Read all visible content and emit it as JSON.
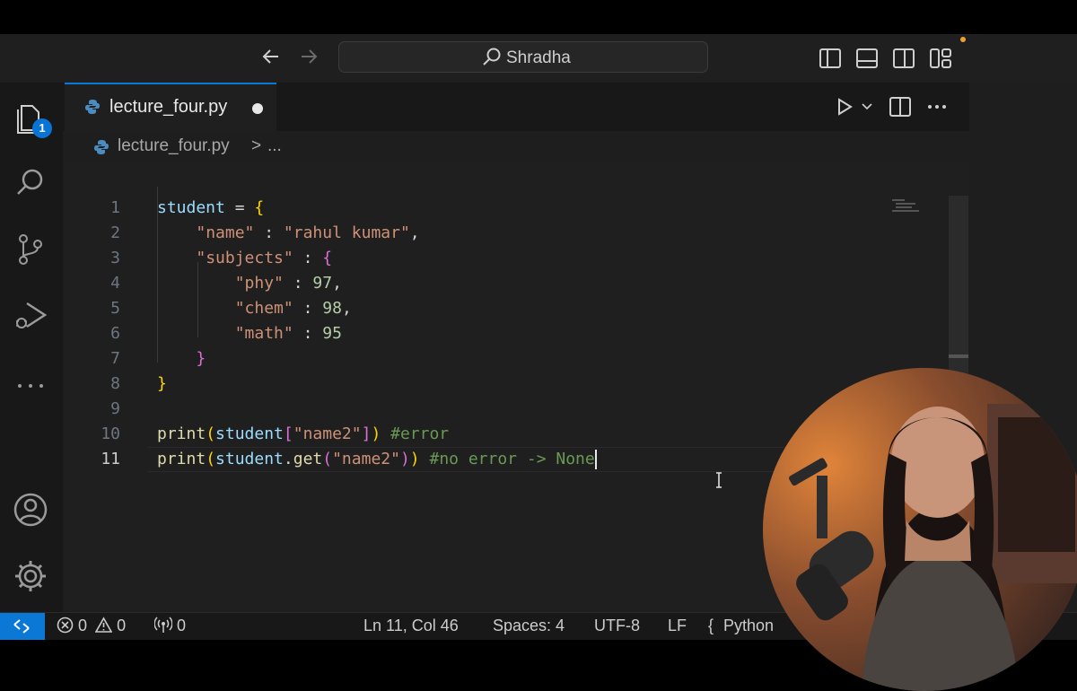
{
  "titlebar": {
    "back_icon": "arrow-left-icon",
    "forward_icon": "arrow-right-icon",
    "search_text": "Shradha",
    "layout_icons": [
      "toggle-primary-sidebar-icon",
      "toggle-panel-icon",
      "toggle-secondary-sidebar-icon",
      "customize-layout-icon"
    ]
  },
  "activity_bar": {
    "items": [
      "explorer-icon",
      "search-icon",
      "source-control-icon",
      "run-and-debug-icon",
      "more-icon"
    ],
    "explorer_badge": "1",
    "bottom_items": [
      "account-icon",
      "settings-icon"
    ]
  },
  "tab": {
    "label": "lecture_four.py",
    "modified": true
  },
  "editor_actions": [
    "run-python-file-icon",
    "run-dropdown-icon",
    "split-editor-icon",
    "more-actions-icon"
  ],
  "breadcrumb": {
    "file": "lecture_four.py",
    "separator": ">",
    "rest": "..."
  },
  "code": {
    "line_numbers": [
      "1",
      "2",
      "3",
      "4",
      "5",
      "6",
      "7",
      "8",
      "9",
      "10",
      "11"
    ],
    "active_line": 11,
    "lines": [
      [
        {
          "t": "student",
          "c": "var"
        },
        {
          "t": " = ",
          "c": "plain"
        },
        {
          "t": "{",
          "c": "b1"
        }
      ],
      [
        {
          "t": "    ",
          "c": "plain"
        },
        {
          "t": "\"name\"",
          "c": "str"
        },
        {
          "t": " : ",
          "c": "plain"
        },
        {
          "t": "\"rahul kumar\"",
          "c": "str"
        },
        {
          "t": ",",
          "c": "plain"
        }
      ],
      [
        {
          "t": "    ",
          "c": "plain"
        },
        {
          "t": "\"subjects\"",
          "c": "str"
        },
        {
          "t": " : ",
          "c": "plain"
        },
        {
          "t": "{",
          "c": "b2"
        }
      ],
      [
        {
          "t": "        ",
          "c": "plain"
        },
        {
          "t": "\"phy\"",
          "c": "str"
        },
        {
          "t": " : ",
          "c": "plain"
        },
        {
          "t": "97",
          "c": "num"
        },
        {
          "t": ",",
          "c": "plain"
        }
      ],
      [
        {
          "t": "        ",
          "c": "plain"
        },
        {
          "t": "\"chem\"",
          "c": "str"
        },
        {
          "t": " : ",
          "c": "plain"
        },
        {
          "t": "98",
          "c": "num"
        },
        {
          "t": ",",
          "c": "plain"
        }
      ],
      [
        {
          "t": "        ",
          "c": "plain"
        },
        {
          "t": "\"math\"",
          "c": "str"
        },
        {
          "t": " : ",
          "c": "plain"
        },
        {
          "t": "95",
          "c": "num"
        }
      ],
      [
        {
          "t": "    ",
          "c": "plain"
        },
        {
          "t": "}",
          "c": "b2"
        }
      ],
      [
        {
          "t": "}",
          "c": "b1"
        }
      ],
      [],
      [
        {
          "t": "print",
          "c": "fn"
        },
        {
          "t": "(",
          "c": "b1"
        },
        {
          "t": "student",
          "c": "var"
        },
        {
          "t": "[",
          "c": "b2"
        },
        {
          "t": "\"name2\"",
          "c": "str"
        },
        {
          "t": "]",
          "c": "b2"
        },
        {
          "t": ")",
          "c": "b1"
        },
        {
          "t": " ",
          "c": "plain"
        },
        {
          "t": "#error",
          "c": "cmt"
        }
      ],
      [
        {
          "t": "print",
          "c": "fn"
        },
        {
          "t": "(",
          "c": "b1"
        },
        {
          "t": "student",
          "c": "var"
        },
        {
          "t": ".",
          "c": "plain"
        },
        {
          "t": "get",
          "c": "fn"
        },
        {
          "t": "(",
          "c": "b2"
        },
        {
          "t": "\"name2\"",
          "c": "str"
        },
        {
          "t": ")",
          "c": "b2"
        },
        {
          "t": ")",
          "c": "b1"
        },
        {
          "t": " ",
          "c": "plain"
        },
        {
          "t": "#no error -> None",
          "c": "cmt"
        }
      ]
    ]
  },
  "status_bar": {
    "remote_icon": "remote-indicator-icon",
    "errors": "0",
    "warnings": "0",
    "ports": "0",
    "position": "Ln 11, Col 46",
    "indentation": "Spaces: 4",
    "encoding": "UTF-8",
    "eol": "LF",
    "language_prefix": "{",
    "language": "Python"
  },
  "colors": {
    "accent": "#0a78d4",
    "background": "#1f1f1f",
    "string": "#ce9178",
    "keyword_var": "#9cdcfe",
    "function": "#dcdcaa",
    "comment": "#6a9955"
  }
}
